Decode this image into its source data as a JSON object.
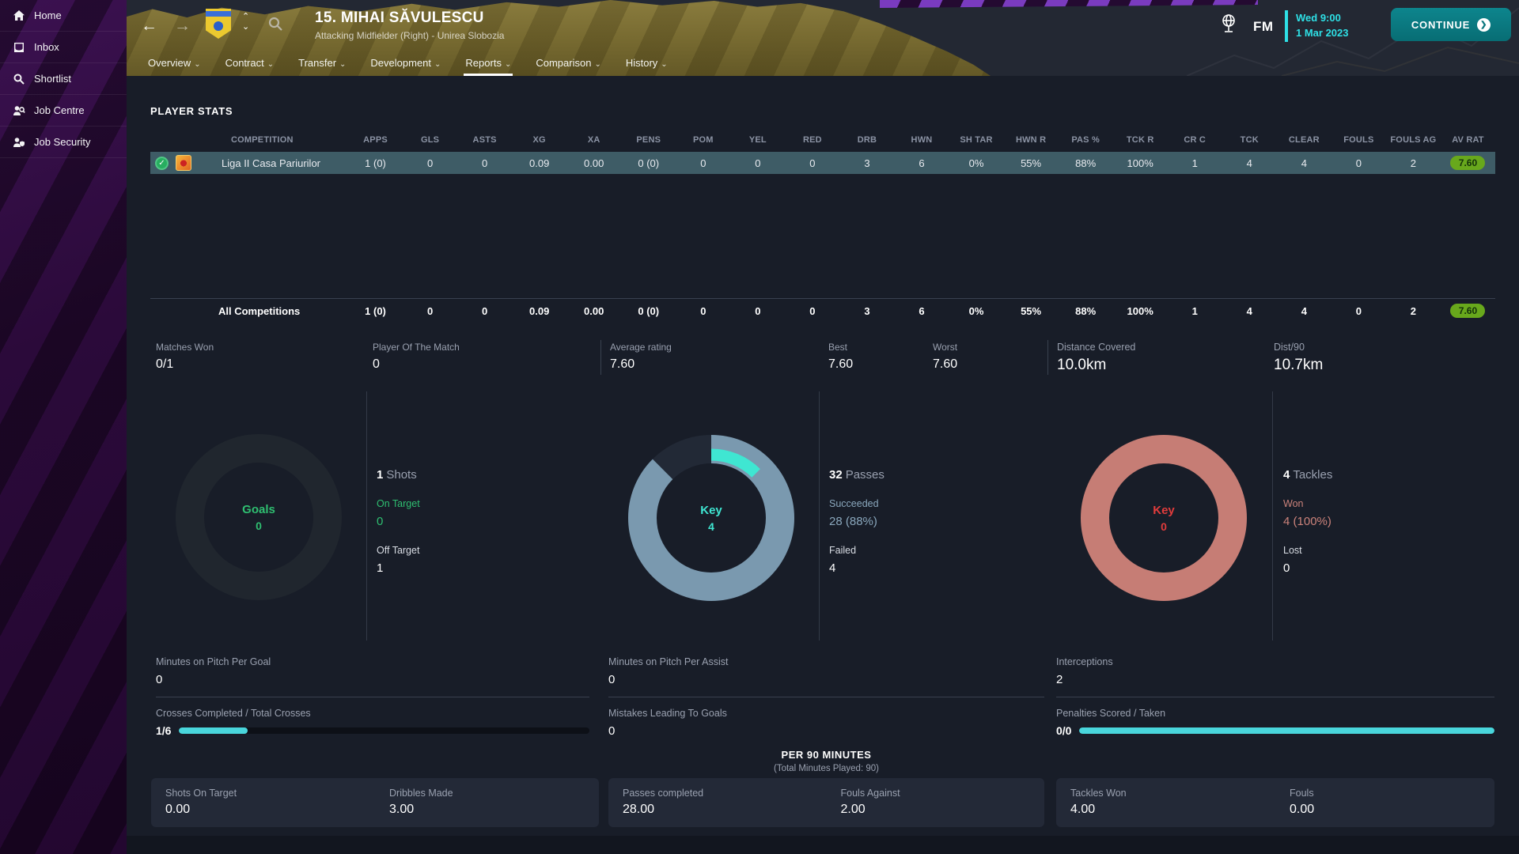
{
  "colors": {
    "accent_cyan": "#2ee0e6",
    "gold_header": "#786b31",
    "sidebar_purple": "#2b0a3a",
    "row_highlight": "#3e5c66",
    "rating_green": "#68a81c",
    "pass_blue": "#7a99af",
    "key_cyan": "#3fe6d2",
    "tackle_salmon": "#c67d75",
    "goal_green": "#2fbf71",
    "key_red": "#e23c3c",
    "continue_teal": "#0a767d"
  },
  "sidebar": {
    "items": [
      {
        "label": "Home"
      },
      {
        "label": "Inbox"
      },
      {
        "label": "Shortlist"
      },
      {
        "label": "Job Centre"
      },
      {
        "label": "Job Security"
      }
    ]
  },
  "header": {
    "player_name": "15. MIHAI SĂVULESCU",
    "player_info": "Attacking Midfielder (Right) - Unirea Slobozia",
    "fm_logo": "FM",
    "clock_day_time": "Wed 9:00",
    "clock_date": "1 Mar 2023",
    "continue_label": "CONTINUE",
    "nav": [
      {
        "label": "Overview"
      },
      {
        "label": "Contract"
      },
      {
        "label": "Transfer"
      },
      {
        "label": "Development"
      },
      {
        "label": "Reports"
      },
      {
        "label": "Comparison"
      },
      {
        "label": "History"
      }
    ],
    "active_tab": "Reports"
  },
  "player_stats": {
    "title": "PLAYER STATS",
    "columns": [
      "COMPETITION",
      "APPS",
      "GLS",
      "ASTS",
      "XG",
      "XA",
      "PENS",
      "POM",
      "YEL",
      "RED",
      "DRB",
      "HWN",
      "SH TAR",
      "HWN R",
      "PAS %",
      "TCK R",
      "CR C",
      "TCK",
      "CLEAR",
      "FOULS",
      "FOULS AG",
      "AV RAT"
    ],
    "rows": [
      {
        "competition": "Liga II Casa Pariurilor",
        "values": [
          "1 (0)",
          "0",
          "0",
          "0.09",
          "0.00",
          "0 (0)",
          "0",
          "0",
          "0",
          "3",
          "6",
          "0%",
          "55%",
          "88%",
          "100%",
          "1",
          "4",
          "4",
          "0",
          "2"
        ],
        "rating": "7.60",
        "selected": true
      }
    ],
    "total_row": {
      "label": "All Competitions",
      "values": [
        "1 (0)",
        "0",
        "0",
        "0.09",
        "0.00",
        "0 (0)",
        "0",
        "0",
        "0",
        "3",
        "6",
        "0%",
        "55%",
        "88%",
        "100%",
        "1",
        "4",
        "4",
        "0",
        "2"
      ],
      "rating": "7.60"
    }
  },
  "summary": {
    "matches_won": {
      "label": "Matches Won",
      "value": "0/1"
    },
    "potm": {
      "label": "Player Of The Match",
      "value": "0"
    },
    "avg_rating": {
      "label": "Average rating",
      "value": "7.60"
    },
    "best": {
      "label": "Best",
      "value": "7.60"
    },
    "worst": {
      "label": "Worst",
      "value": "7.60"
    },
    "distance": {
      "label": "Distance Covered",
      "value": "10.0km"
    },
    "dist_per_90": {
      "label": "Dist/90",
      "value": "10.7km"
    }
  },
  "donut_section": {
    "goals": {
      "center_label": "Goals",
      "center_value": "0",
      "stat_value": "1",
      "stat_label": "Shots",
      "positive_label": "On Target",
      "positive_value": "0",
      "neutral_label": "Off Target",
      "neutral_value": "1"
    },
    "passes": {
      "center_label": "Key",
      "center_value": "4",
      "stat_value": "32",
      "stat_label": "Passes",
      "positive_label": "Succeeded",
      "positive_value": "28 (88%)",
      "neutral_label": "Failed",
      "neutral_value": "4"
    },
    "tackles": {
      "center_label": "Key",
      "center_value": "0",
      "stat_value": "4",
      "stat_label": "Tackles",
      "positive_label": "Won",
      "positive_value": "4 (100%)",
      "neutral_label": "Lost",
      "neutral_value": "0"
    }
  },
  "donut_charts": {
    "goals": {
      "type": "donut",
      "filled_pct": 0
    },
    "passes": {
      "type": "donut",
      "succeeded_pct": 87.5,
      "key_pct": 12.5,
      "total": 32,
      "succeeded": 28,
      "failed": 4,
      "key": 4
    },
    "tackles": {
      "type": "donut",
      "won_pct": 100,
      "total": 4,
      "won": 4,
      "lost": 0,
      "key": 0
    }
  },
  "detail_stats": {
    "col1": [
      {
        "label": "Minutes on Pitch Per Goal",
        "value": "0"
      },
      {
        "label": "Crosses Completed / Total Crosses",
        "value": "1/6",
        "bar_percent": 16.7
      }
    ],
    "col2": [
      {
        "label": "Minutes on Pitch Per Assist",
        "value": "0"
      },
      {
        "label": "Mistakes Leading To Goals",
        "value": "0"
      }
    ],
    "col3": [
      {
        "label": "Interceptions",
        "value": "2"
      },
      {
        "label": "Penalties Scored / Taken",
        "value": "0/0",
        "bar_percent": 100
      }
    ]
  },
  "per90": {
    "title": "PER 90 MINUTES",
    "subtitle": "(Total Minutes Played: 90)",
    "cards": [
      {
        "stats": [
          {
            "label": "Shots On Target",
            "value": "0.00"
          },
          {
            "label": "Dribbles Made",
            "value": "3.00"
          }
        ]
      },
      {
        "stats": [
          {
            "label": "Passes completed",
            "value": "28.00"
          },
          {
            "label": "Fouls Against",
            "value": "2.00"
          }
        ]
      },
      {
        "stats": [
          {
            "label": "Tackles Won",
            "value": "4.00"
          },
          {
            "label": "Fouls",
            "value": "0.00"
          }
        ]
      }
    ]
  }
}
